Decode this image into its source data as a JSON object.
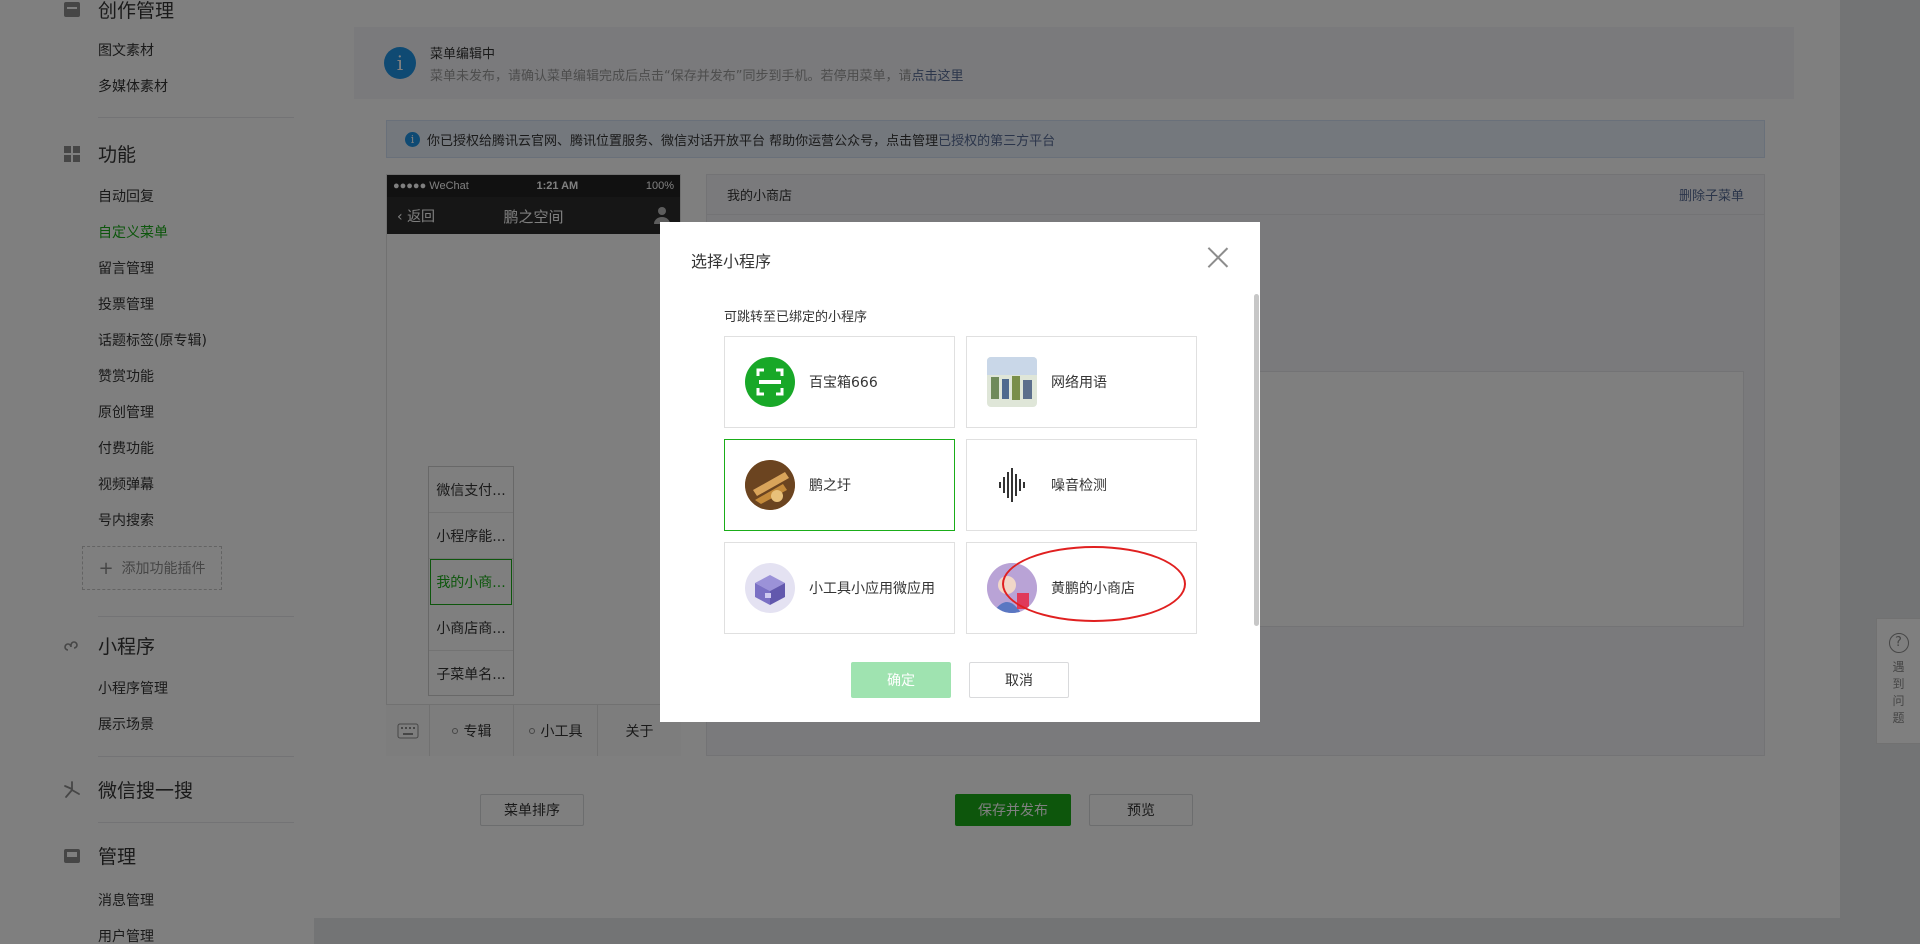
{
  "sidebar": {
    "sections": [
      {
        "label": "创作管理",
        "icon": "document-icon"
      },
      {
        "label": "功能",
        "icon": "grid-icon"
      },
      {
        "label": "小程序",
        "icon": "miniprogram-icon"
      },
      {
        "label": "微信搜一搜",
        "icon": "search-spark-icon"
      },
      {
        "label": "管理",
        "icon": "inbox-icon"
      }
    ],
    "creation_items": [
      "图文素材",
      "多媒体素材"
    ],
    "function_items": [
      "自动回复",
      "自定义菜单",
      "留言管理",
      "投票管理",
      "话题标签(原专辑)",
      "赞赏功能",
      "原创管理",
      "付费功能",
      "视频弹幕",
      "号内搜索"
    ],
    "add_plugin": "添加功能插件",
    "miniprogram_items": [
      "小程序管理",
      "展示场景"
    ],
    "manage_items": [
      "消息管理",
      "用户管理"
    ]
  },
  "notice": {
    "title": "菜单编辑中",
    "text": "菜单未发布，请确认菜单编辑完成后点击“保存并发布”同步到手机。若停用菜单，请",
    "link": "点击这里"
  },
  "authbar": {
    "text": "你已授权给腾讯云官网、腾讯位置服务、微信对话开放平台  帮助你运营公众号，点击管理",
    "link": "已授权的第三方平台"
  },
  "phone": {
    "carrier": "●●●●● WeChat ",
    "time": "1:21 AM",
    "battery": "100%",
    "back": "返回",
    "title": "鹏之空间",
    "submenu": [
      "微信支付...",
      "小程序能...",
      "我的小商...",
      "小商店商...",
      "子菜单名..."
    ],
    "menu": [
      "专辑",
      "小工具",
      "关于"
    ]
  },
  "editor": {
    "menu_name": "我的小商店",
    "delete": "删除子菜单"
  },
  "buttons": {
    "sort": "菜单排序",
    "save": "保存并发布",
    "preview": "预览"
  },
  "dialog": {
    "title": "选择小程序",
    "subtitle": "可跳转至已绑定的小程序",
    "cards": [
      {
        "name": "百宝箱666"
      },
      {
        "name": "网络用语"
      },
      {
        "name": "鹏之圩"
      },
      {
        "name": "噪音检测"
      },
      {
        "name": "小工具小应用微应用"
      },
      {
        "name": "黄鹏的小商店"
      }
    ],
    "ok": "确定",
    "cancel": "取消"
  },
  "help": {
    "icon": "?",
    "text": "遇到问题"
  },
  "colors": {
    "brand_green": "#1aad19",
    "link_blue": "#576b95",
    "info_blue": "#1e94e6",
    "annotation_red": "#e02020"
  }
}
